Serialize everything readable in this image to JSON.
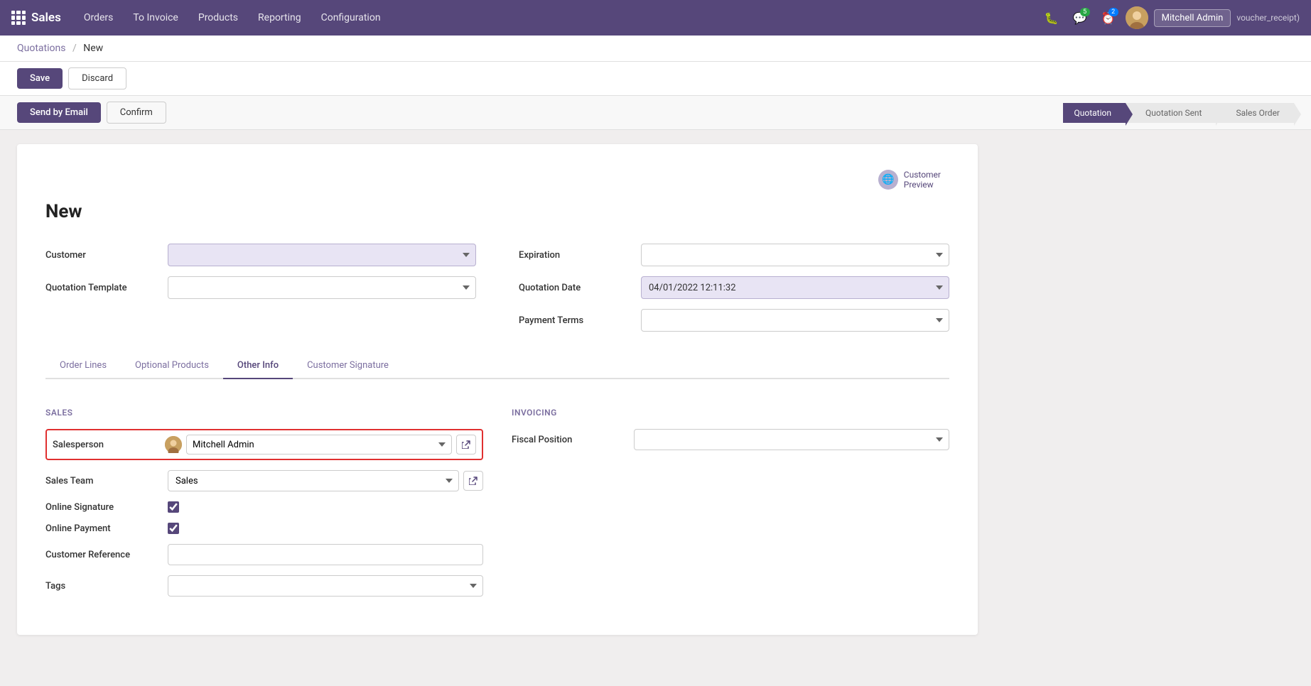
{
  "app": {
    "brand": "Sales",
    "nav_items": [
      "Orders",
      "To Invoice",
      "Products",
      "Reporting",
      "Configuration"
    ]
  },
  "nav_right": {
    "bug_icon_label": "bug",
    "messages_badge": "5",
    "activity_badge": "2",
    "user_name": "Mitchell Admin",
    "user_suffix": "voucher_receipt)"
  },
  "breadcrumb": {
    "parent": "Quotations",
    "separator": "/",
    "current": "New"
  },
  "toolbar": {
    "save_label": "Save",
    "discard_label": "Discard"
  },
  "action_bar": {
    "send_email_label": "Send by Email",
    "confirm_label": "Confirm"
  },
  "status_pipeline": [
    {
      "label": "Quotation",
      "active": true
    },
    {
      "label": "Quotation Sent",
      "active": false
    },
    {
      "label": "Sales Order",
      "active": false
    }
  ],
  "form": {
    "title": "New",
    "customer_preview_label": "Customer\nPreview",
    "fields_left": [
      {
        "label": "Customer",
        "value": "",
        "highlighted": true,
        "type": "select"
      },
      {
        "label": "Quotation Template",
        "value": "",
        "highlighted": false,
        "type": "select"
      }
    ],
    "fields_right": [
      {
        "label": "Expiration",
        "value": "",
        "highlighted": false,
        "type": "select"
      },
      {
        "label": "Quotation Date",
        "value": "04/01/2022 12:11:32",
        "highlighted": true,
        "type": "select"
      },
      {
        "label": "Payment Terms",
        "value": "",
        "highlighted": false,
        "type": "select"
      }
    ]
  },
  "tabs": [
    {
      "label": "Order Lines",
      "active": false
    },
    {
      "label": "Optional Products",
      "active": false
    },
    {
      "label": "Other Info",
      "active": true
    },
    {
      "label": "Customer Signature",
      "active": false
    }
  ],
  "other_info": {
    "sales_section": "Sales",
    "invoicing_section": "Invoicing",
    "salesperson_label": "Salesperson",
    "salesperson_value": "Mitchell Admin",
    "sales_team_label": "Sales Team",
    "sales_team_value": "Sales",
    "online_signature_label": "Online Signature",
    "online_signature_checked": true,
    "online_payment_label": "Online Payment",
    "online_payment_checked": true,
    "customer_reference_label": "Customer Reference",
    "customer_reference_value": "",
    "tags_label": "Tags",
    "tags_value": "",
    "fiscal_position_label": "Fiscal Position",
    "fiscal_position_value": ""
  }
}
